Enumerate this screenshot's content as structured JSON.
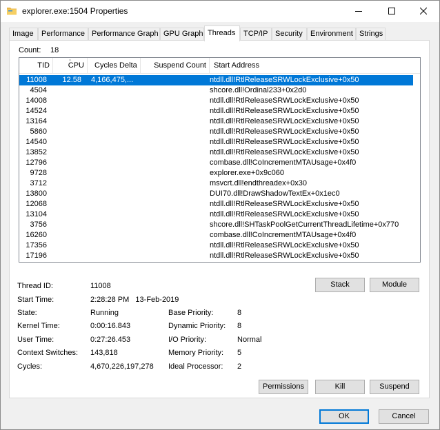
{
  "window": {
    "title": "explorer.exe:1504 Properties",
    "controls": {
      "minimize": "minimize",
      "maximize": "maximize",
      "close": "close"
    }
  },
  "tabs": [
    {
      "label": "Image",
      "active": false
    },
    {
      "label": "Performance",
      "active": false
    },
    {
      "label": "Performance Graph",
      "active": false
    },
    {
      "label": "GPU Graph",
      "active": false
    },
    {
      "label": "Threads",
      "active": true
    },
    {
      "label": "TCP/IP",
      "active": false
    },
    {
      "label": "Security",
      "active": false
    },
    {
      "label": "Environment",
      "active": false
    },
    {
      "label": "Strings",
      "active": false
    }
  ],
  "count": {
    "label": "Count:",
    "value": "18"
  },
  "columns": {
    "tid": "TID",
    "cpu": "CPU",
    "cycles_delta": "Cycles Delta",
    "suspend_count": "Suspend Count",
    "start_address": "Start Address"
  },
  "rows": [
    {
      "tid": "11008",
      "cpu": "12.58",
      "cycles": "4,166,475,...",
      "suspend": "",
      "addr": "ntdll.dll!RtlReleaseSRWLockExclusive+0x50",
      "selected": true
    },
    {
      "tid": "4504",
      "cpu": "",
      "cycles": "",
      "suspend": "",
      "addr": "shcore.dll!Ordinal233+0x2d0",
      "selected": false
    },
    {
      "tid": "14008",
      "cpu": "",
      "cycles": "",
      "suspend": "",
      "addr": "ntdll.dll!RtlReleaseSRWLockExclusive+0x50",
      "selected": false
    },
    {
      "tid": "14524",
      "cpu": "",
      "cycles": "",
      "suspend": "",
      "addr": "ntdll.dll!RtlReleaseSRWLockExclusive+0x50",
      "selected": false
    },
    {
      "tid": "13164",
      "cpu": "",
      "cycles": "",
      "suspend": "",
      "addr": "ntdll.dll!RtlReleaseSRWLockExclusive+0x50",
      "selected": false
    },
    {
      "tid": "5860",
      "cpu": "",
      "cycles": "",
      "suspend": "",
      "addr": "ntdll.dll!RtlReleaseSRWLockExclusive+0x50",
      "selected": false
    },
    {
      "tid": "14540",
      "cpu": "",
      "cycles": "",
      "suspend": "",
      "addr": "ntdll.dll!RtlReleaseSRWLockExclusive+0x50",
      "selected": false
    },
    {
      "tid": "13852",
      "cpu": "",
      "cycles": "",
      "suspend": "",
      "addr": "ntdll.dll!RtlReleaseSRWLockExclusive+0x50",
      "selected": false
    },
    {
      "tid": "12796",
      "cpu": "",
      "cycles": "",
      "suspend": "",
      "addr": "combase.dll!CoIncrementMTAUsage+0x4f0",
      "selected": false
    },
    {
      "tid": "9728",
      "cpu": "",
      "cycles": "",
      "suspend": "",
      "addr": "explorer.exe+0x9c060",
      "selected": false
    },
    {
      "tid": "3712",
      "cpu": "",
      "cycles": "",
      "suspend": "",
      "addr": "msvcrt.dll!endthreadex+0x30",
      "selected": false
    },
    {
      "tid": "13800",
      "cpu": "",
      "cycles": "",
      "suspend": "",
      "addr": "DUI70.dll!DrawShadowTextEx+0x1ec0",
      "selected": false
    },
    {
      "tid": "12068",
      "cpu": "",
      "cycles": "",
      "suspend": "",
      "addr": "ntdll.dll!RtlReleaseSRWLockExclusive+0x50",
      "selected": false
    },
    {
      "tid": "13104",
      "cpu": "",
      "cycles": "",
      "suspend": "",
      "addr": "ntdll.dll!RtlReleaseSRWLockExclusive+0x50",
      "selected": false
    },
    {
      "tid": "3756",
      "cpu": "",
      "cycles": "",
      "suspend": "",
      "addr": "shcore.dll!SHTaskPoolGetCurrentThreadLifetime+0x770",
      "selected": false
    },
    {
      "tid": "16260",
      "cpu": "",
      "cycles": "",
      "suspend": "",
      "addr": "combase.dll!CoIncrementMTAUsage+0x4f0",
      "selected": false
    },
    {
      "tid": "17356",
      "cpu": "",
      "cycles": "",
      "suspend": "",
      "addr": "ntdll.dll!RtlReleaseSRWLockExclusive+0x50",
      "selected": false
    },
    {
      "tid": "17196",
      "cpu": "",
      "cycles": "",
      "suspend": "",
      "addr": "ntdll.dll!RtlReleaseSRWLockExclusive+0x50",
      "selected": false
    }
  ],
  "details": {
    "thread_id": {
      "label": "Thread ID:",
      "value": "11008"
    },
    "start_time": {
      "label": "Start Time:",
      "value": "2:28:28 PM   13-Feb-2019"
    },
    "state": {
      "label": "State:",
      "value": "Running"
    },
    "kernel_time": {
      "label": "Kernel Time:",
      "value": "0:00:16.843"
    },
    "user_time": {
      "label": "User Time:",
      "value": "0:27:26.453"
    },
    "context_switches": {
      "label": "Context Switches:",
      "value": "143,818"
    },
    "cycles": {
      "label": "Cycles:",
      "value": "4,670,226,197,278"
    },
    "base_priority": {
      "label": "Base Priority:",
      "value": "8"
    },
    "dynamic_priority": {
      "label": "Dynamic Priority:",
      "value": "8"
    },
    "io_priority": {
      "label": "I/O Priority:",
      "value": "Normal"
    },
    "memory_priority": {
      "label": "Memory Priority:",
      "value": "5"
    },
    "ideal_processor": {
      "label": "Ideal Processor:",
      "value": "2"
    }
  },
  "buttons": {
    "stack": "Stack",
    "module": "Module",
    "permissions": "Permissions",
    "kill": "Kill",
    "suspend": "Suspend",
    "ok": "OK",
    "cancel": "Cancel"
  },
  "colors": {
    "selection": "#0078d7",
    "button_face": "#e1e1e1",
    "dialog_bg": "#f0f0f0"
  }
}
